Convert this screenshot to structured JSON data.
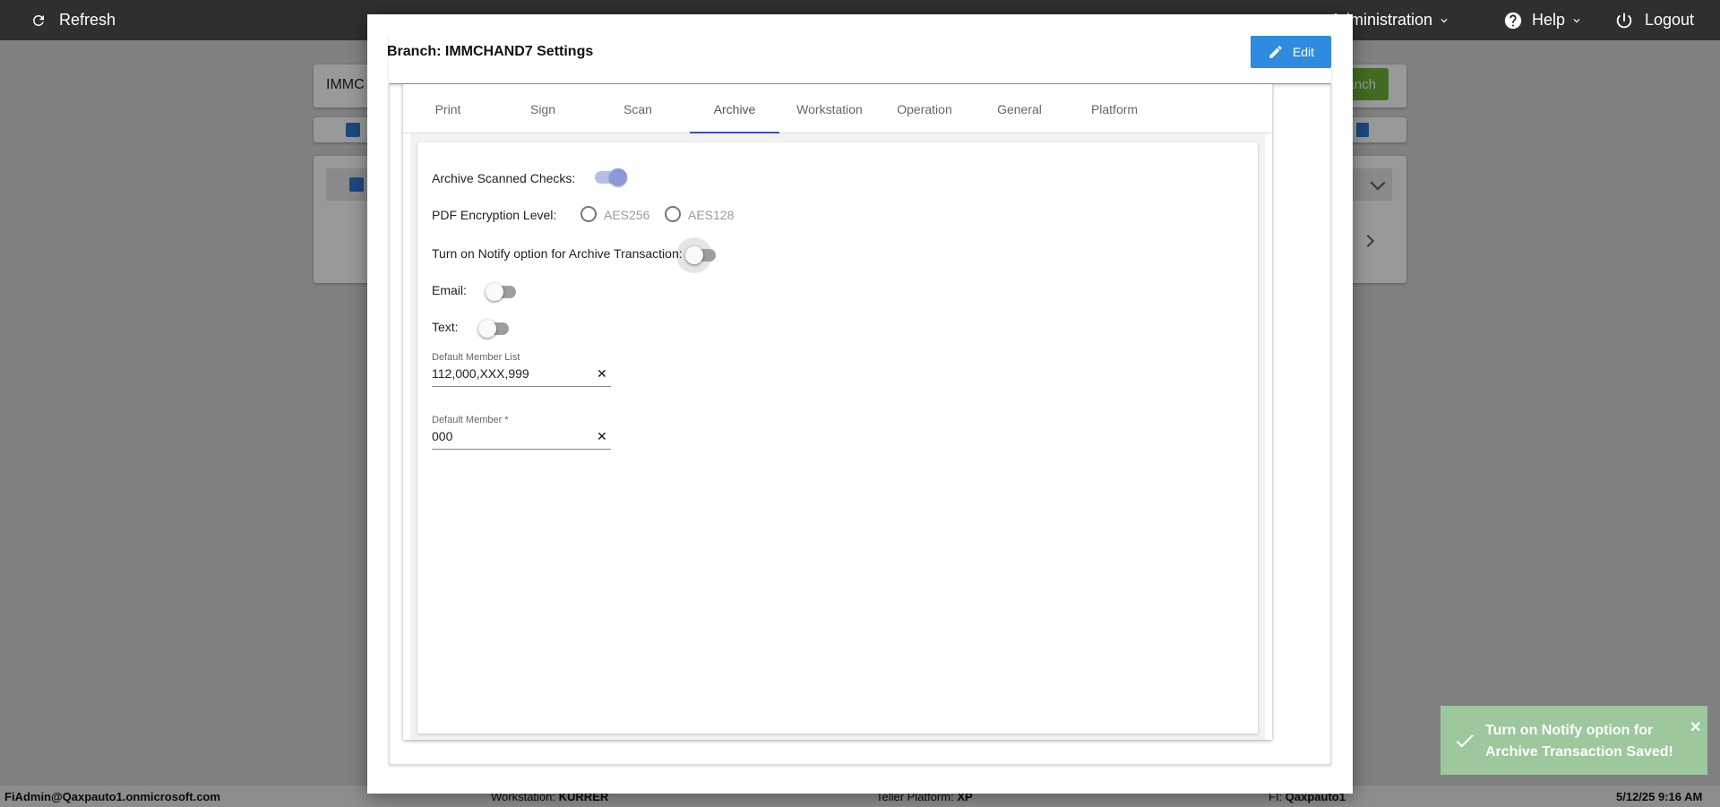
{
  "topbar": {
    "refresh_label": "Refresh",
    "administration_label": "Administration",
    "help_label": "Help",
    "logout_label": "Logout"
  },
  "background": {
    "search_value": "IMMC",
    "add_branch_label": "anch"
  },
  "modal": {
    "title": "Branch: IMMCHAND7 Settings",
    "edit_label": "Edit",
    "tabs": [
      {
        "label": "Print"
      },
      {
        "label": "Sign"
      },
      {
        "label": "Scan"
      },
      {
        "label": "Archive"
      },
      {
        "label": "Workstation"
      },
      {
        "label": "Operation"
      },
      {
        "label": "General"
      },
      {
        "label": "Platform"
      }
    ],
    "active_tab": "Archive",
    "archive": {
      "archive_scanned_checks_label": "Archive Scanned Checks:",
      "archive_scanned_checks_on": true,
      "pdf_encryption_label": "PDF Encryption Level:",
      "pdf_options": [
        "AES256",
        "AES128"
      ],
      "notify_label": "Turn on Notify option for Archive Transaction:",
      "notify_on": false,
      "email_label": "Email:",
      "email_on": false,
      "text_label": "Text:",
      "text_on": false,
      "default_member_list_label": "Default Member List",
      "default_member_list_value": "112,000,XXX,999",
      "default_member_label": "Default Member *",
      "default_member_value": "000"
    }
  },
  "toast": {
    "message": "Turn on Notify option for Archive Transaction Saved!"
  },
  "footer": {
    "user": "FiAdmin@Qaxpauto1.onmicrosoft.com",
    "workstation_label": "Workstation:",
    "workstation_value": "KURRER",
    "teller_platform_label": "Teller Platform:",
    "teller_platform_value": "XP",
    "fi_label": "FI:",
    "fi_value": "Qaxpauto1",
    "datetime": "5/12/25 9:16 AM"
  },
  "colors": {
    "accent": "#3f51b5",
    "edit_button": "#2e8be0",
    "toast": "#9dc79c",
    "topbar": "#2f2f2f"
  }
}
